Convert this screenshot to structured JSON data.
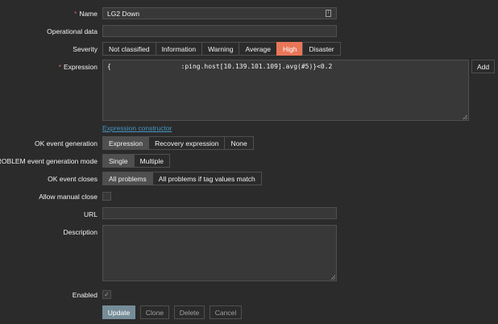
{
  "form": {
    "name": {
      "label": "Name",
      "required": "*",
      "value": "LG2 Down",
      "icon": "text-format-icon"
    },
    "operational_data": {
      "label": "Operational data",
      "value": ""
    },
    "severity": {
      "label": "Severity",
      "options": [
        "Not classified",
        "Information",
        "Warning",
        "Average",
        "High",
        "Disaster"
      ],
      "selected": "High"
    },
    "expression": {
      "label": "Expression",
      "required": "*",
      "value": "{                  :ping.host[10.139.101.109].avg(#5)}<0.2",
      "add_label": "Add",
      "constructor_link": "Expression constructor"
    },
    "ok_event_generation": {
      "label": "OK event generation",
      "options": [
        "Expression",
        "Recovery expression",
        "None"
      ],
      "selected": "Expression"
    },
    "problem_mode": {
      "label": "PROBLEM event generation mode",
      "options": [
        "Single",
        "Multiple"
      ],
      "selected": "Single"
    },
    "ok_event_closes": {
      "label": "OK event closes",
      "options": [
        "All problems",
        "All problems if tag values match"
      ],
      "selected": "All problems"
    },
    "allow_manual_close": {
      "label": "Allow manual close",
      "checked": false
    },
    "url": {
      "label": "URL",
      "value": ""
    },
    "description": {
      "label": "Description",
      "value": ""
    },
    "enabled": {
      "label": "Enabled",
      "checked": true,
      "mark": "✓"
    }
  },
  "buttons": {
    "update": "Update",
    "clone": "Clone",
    "delete": "Delete",
    "cancel": "Cancel"
  },
  "colors": {
    "background": "#2b2b2b",
    "high": "#e97659",
    "link": "#4796c4",
    "primary": "#768d99"
  }
}
